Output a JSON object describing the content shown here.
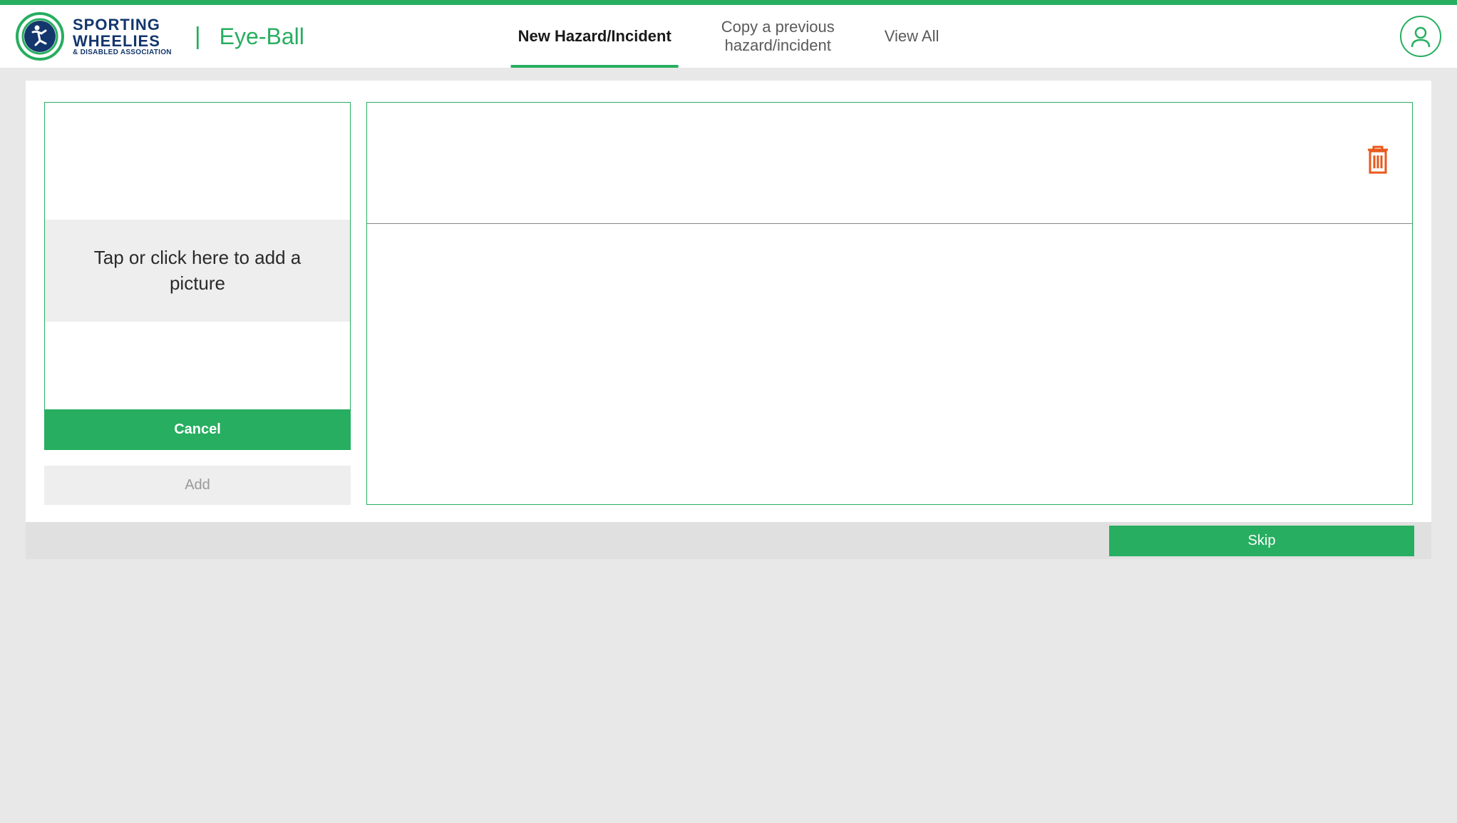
{
  "header": {
    "logo": {
      "line1": "SPORTING",
      "line2": "WHEELIES",
      "line3": "& DISABLED ASSOCIATION"
    },
    "app_name": "Eye-Ball",
    "tabs": [
      {
        "label": "New Hazard/Incident",
        "active": true
      },
      {
        "label_line1": "Copy a previous",
        "label_line2": "hazard/incident",
        "active": false
      },
      {
        "label": "View All",
        "active": false
      }
    ]
  },
  "picture_panel": {
    "prompt": "Tap or click here to add a picture",
    "cancel_label": "Cancel",
    "add_label": "Add"
  },
  "footer": {
    "skip_label": "Skip"
  }
}
